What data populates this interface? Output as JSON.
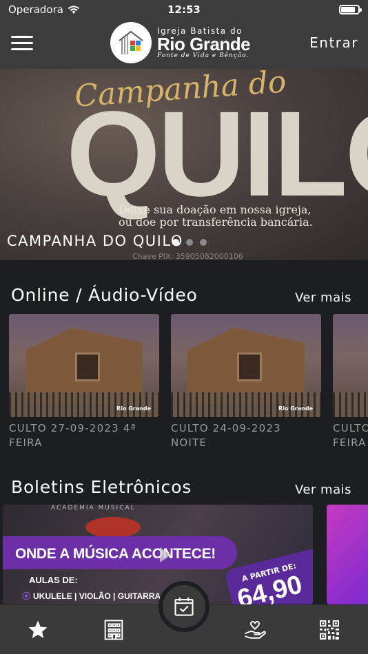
{
  "status_bar": {
    "carrier": "Operadora",
    "time": "12:53",
    "battery_level": 0.85
  },
  "header": {
    "logo_line1": "Igreja Batista do",
    "logo_line2": "Rio Grande",
    "logo_line3": "Fonte de Vida e Bênção.",
    "login_label": "Entrar"
  },
  "hero": {
    "script_text": "Campanha do",
    "big_text": "QUILO",
    "sub_line1": "Deixe sua doação em nossa igreja,",
    "sub_line2": "ou doe por transferência bancária.",
    "pix_text": "Chave PIX: 35905082000106",
    "caption": "CAMPANHA DO QUILO",
    "slide_count": 3,
    "active_slide": 1
  },
  "online_section": {
    "title": "Online / Áudio-Vídeo",
    "see_more": "Ver mais",
    "videos": [
      {
        "line1": "CULTO 27-09-2023 4ª",
        "line2": "FEIRA"
      },
      {
        "line1": "CULTO 24-09-2023",
        "line2": "NOITE"
      },
      {
        "line1": "CULTO",
        "line2": "FEIRA"
      }
    ],
    "thumb_badge": "Rio Grande"
  },
  "bulletins_section": {
    "title": "Boletins Eletrônicos",
    "see_more": "Ver mais",
    "card": {
      "top_label": "ACADEMIA MUSICAL",
      "headline": "ONDE A MÚSICA ACONTECE!",
      "aulas_label": "AULAS DE:",
      "courses": "UKULELE | VIOLÃO | GUITARRA",
      "price_prefix": "A PARTIR DE:",
      "price": "64,90"
    }
  },
  "tabbar": {
    "icons": [
      "star-icon",
      "building-icon",
      "calendar-check-icon",
      "donation-hand-icon",
      "qr-code-icon"
    ]
  }
}
